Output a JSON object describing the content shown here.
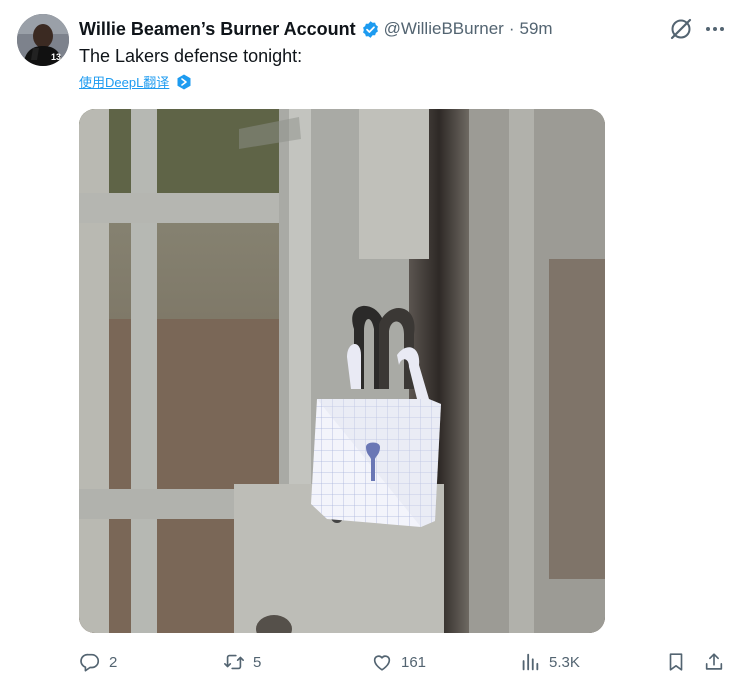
{
  "author": {
    "display_name": "Willie Beamen’s Burner Account",
    "handle": "@WillieBBurner",
    "separator": "·",
    "time": "59m",
    "verified": true
  },
  "post": {
    "text": "The Lakers defense tonight:",
    "translate_label": "使用DeepL翻译"
  },
  "media": {
    "icon": "photo"
  },
  "actions": {
    "replies": "2",
    "reposts": "5",
    "likes": "161",
    "views": "5.3K"
  },
  "icons": [
    "verified-badge-icon",
    "grok-icon",
    "more-icon",
    "deepl-icon",
    "reply-icon",
    "repost-icon",
    "like-icon",
    "views-icon",
    "bookmark-icon",
    "share-icon"
  ],
  "colors": {
    "accent": "#1d9bf0",
    "text": "#0f1419",
    "muted": "#536471"
  }
}
